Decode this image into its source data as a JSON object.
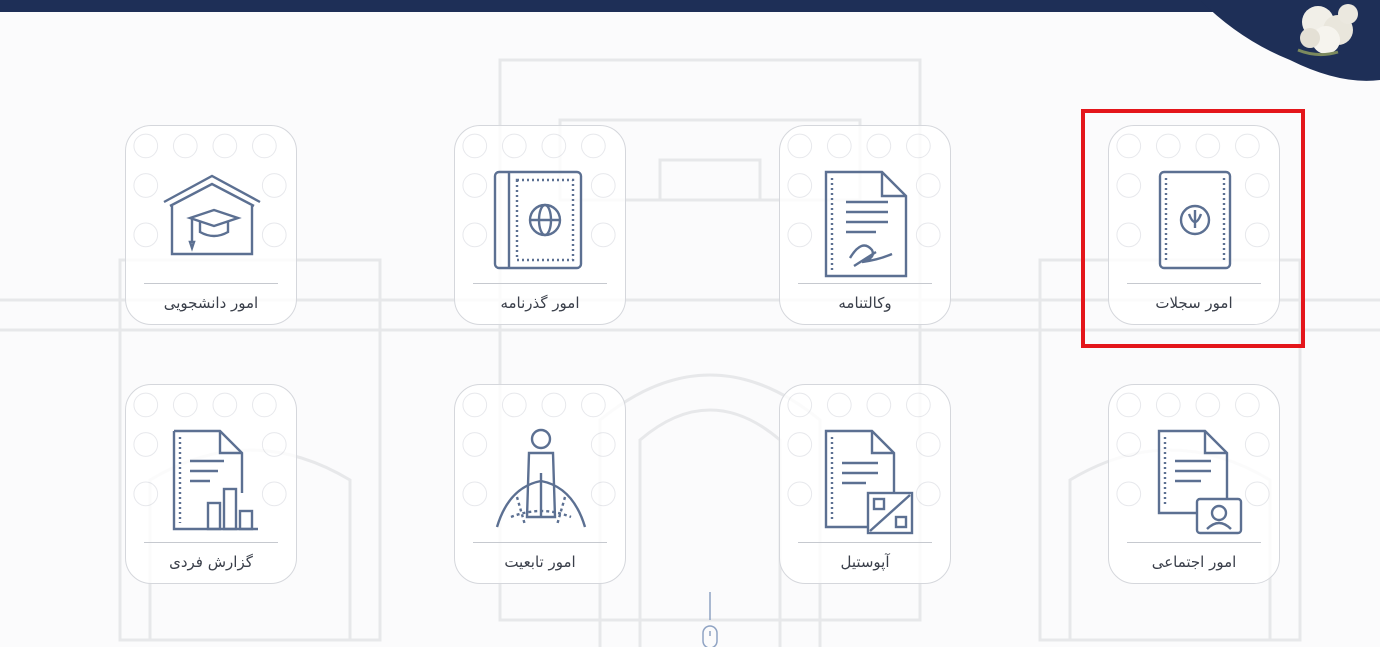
{
  "colors": {
    "topbar": "#1e2f57",
    "icon_stroke": "#5c7092",
    "highlight": "#e4161b",
    "label": "#3a3f4a"
  },
  "tiles": [
    {
      "label": "امور سجلات",
      "icon": "iran-emblem-book-icon",
      "highlighted": true
    },
    {
      "label": "وکالتنامه",
      "icon": "signed-document-icon"
    },
    {
      "label": "امور گذرنامه",
      "icon": "passport-globe-icon"
    },
    {
      "label": "امور دانشجویی",
      "icon": "graduation-cap-house-icon"
    },
    {
      "label": "امور اجتماعی",
      "icon": "document-person-card-icon"
    },
    {
      "label": "آپوستیل",
      "icon": "document-stamp-icon"
    },
    {
      "label": "امور تابعیت",
      "icon": "person-globe-icon"
    },
    {
      "label": "گزارش فردی",
      "icon": "document-bar-chart-icon"
    }
  ]
}
